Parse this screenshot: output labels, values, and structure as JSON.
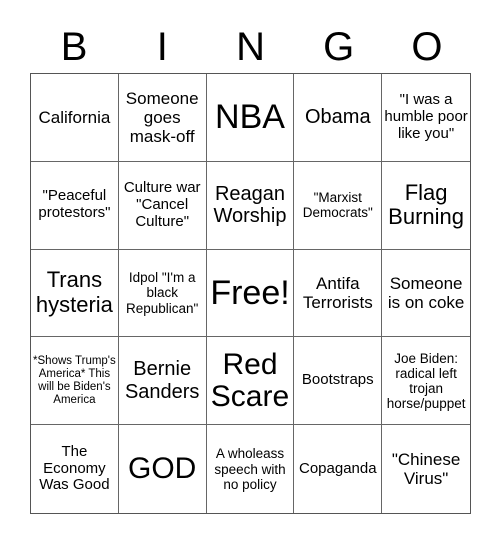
{
  "header": {
    "letters": [
      "B",
      "I",
      "N",
      "G",
      "O"
    ]
  },
  "cells": [
    [
      "California",
      "Someone goes mask-off",
      "NBA",
      "Obama",
      "\"I was a humble poor like you\""
    ],
    [
      "\"Peaceful protestors\"",
      "Culture war \"Cancel Culture\"",
      "Reagan Worship",
      "\"Marxist Democrats\"",
      "Flag Burning"
    ],
    [
      "Trans hysteria",
      "Idpol \"I'm a black Republican\"",
      "Free!",
      "Antifa Terrorists",
      "Someone is on coke"
    ],
    [
      "*Shows Trump's America* This will be Biden's America",
      "Bernie Sanders",
      "Red Scare",
      "Bootstraps",
      "Joe Biden: radical left trojan horse/puppet"
    ],
    [
      "The Economy Was Good",
      "GOD",
      "A wholeass speech with no policy",
      "Copaganda",
      "\"Chinese Virus\""
    ]
  ]
}
